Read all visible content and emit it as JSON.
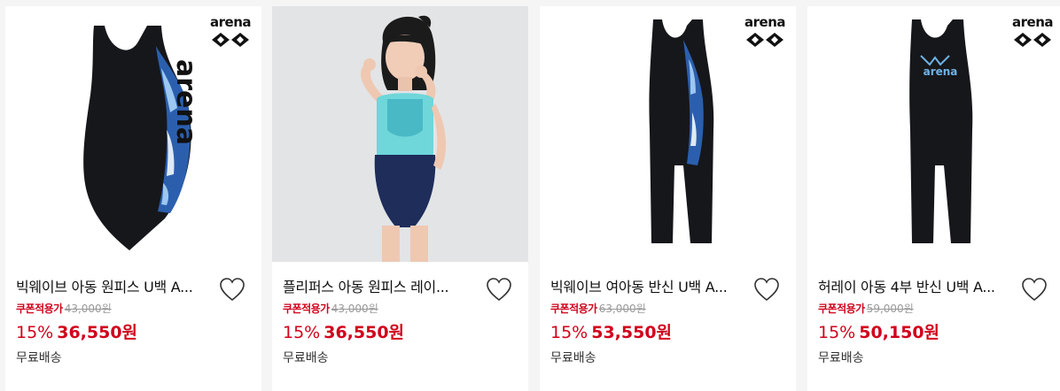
{
  "colors": {
    "sale_red": "#d0021b",
    "text": "#111111",
    "muted": "#999999",
    "bg": "#f5f5f5"
  },
  "products": [
    {
      "brand": "arena",
      "image_desc": "black-blue-wave-onepiece",
      "title": "빅웨이브 아동 원피스 U백 A...",
      "coupon_label": "쿠폰적용가",
      "original_price": "43,000원",
      "discount": "15%",
      "sale_price": "36,550원",
      "shipping": "무료배송",
      "wishlist_icon": "heart-outline-icon"
    },
    {
      "brand": "",
      "image_desc": "child-model-navy-aqua-onepiece",
      "title": "플리퍼스 아동 원피스 레이...",
      "coupon_label": "쿠폰적용가",
      "original_price": "43,000원",
      "discount": "15%",
      "sale_price": "36,550원",
      "shipping": "무료배송",
      "wishlist_icon": "heart-outline-icon"
    },
    {
      "brand": "arena",
      "image_desc": "black-blue-wave-kneesuit",
      "title": "빅웨이브 여아동 반신 U백 A...",
      "coupon_label": "쿠폰적용가",
      "original_price": "63,000원",
      "discount": "15%",
      "sale_price": "53,550원",
      "shipping": "무료배송",
      "wishlist_icon": "heart-outline-icon"
    },
    {
      "brand": "arena",
      "image_desc": "black-kneesuit-arena-logo",
      "title": "허레이 아동 4부 반신 U백 A...",
      "coupon_label": "쿠폰적용가",
      "original_price": "59,000원",
      "discount": "15%",
      "sale_price": "50,150원",
      "shipping": "무료배송",
      "wishlist_icon": "heart-outline-icon"
    }
  ]
}
